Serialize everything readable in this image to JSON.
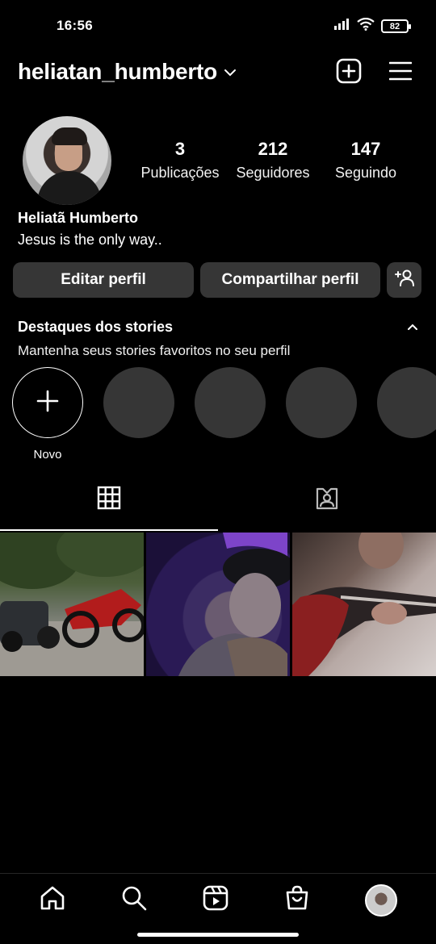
{
  "status_bar": {
    "time": "16:56",
    "battery": "82",
    "icons": [
      "signal-icon",
      "wifi-icon",
      "battery-icon"
    ]
  },
  "header": {
    "username": "heliatan_humberto",
    "icons": [
      "chevron-down-icon",
      "create-post-icon",
      "menu-icon"
    ]
  },
  "profile": {
    "stats": [
      {
        "value": "3",
        "label": "Publicações"
      },
      {
        "value": "212",
        "label": "Seguidores"
      },
      {
        "value": "147",
        "label": "Seguindo"
      }
    ],
    "name": "Heliatã Humberto",
    "bio": "Jesus is the only way.."
  },
  "actions": {
    "edit": "Editar perfil",
    "share": "Compartilhar perfil",
    "discover_icon": "add-person-icon"
  },
  "highlights": {
    "title": "Destaques dos stories",
    "subtitle": "Mantenha seus stories favoritos no seu perfil",
    "new_label": "Novo",
    "placeholders": 4
  },
  "tabs": [
    {
      "name": "posts-grid",
      "icon": "grid-icon",
      "active": true
    },
    {
      "name": "tagged",
      "icon": "tagged-person-icon",
      "active": false
    }
  ],
  "posts": [
    {
      "description_icon": "photo-post"
    },
    {
      "description_icon": "photo-post"
    },
    {
      "description_icon": "photo-post"
    }
  ],
  "bottom_nav": [
    "home-icon",
    "search-icon",
    "reels-icon",
    "shop-icon",
    "profile-avatar"
  ],
  "colors": {
    "background": "#000000",
    "button": "#363636",
    "text": "#ffffff"
  }
}
